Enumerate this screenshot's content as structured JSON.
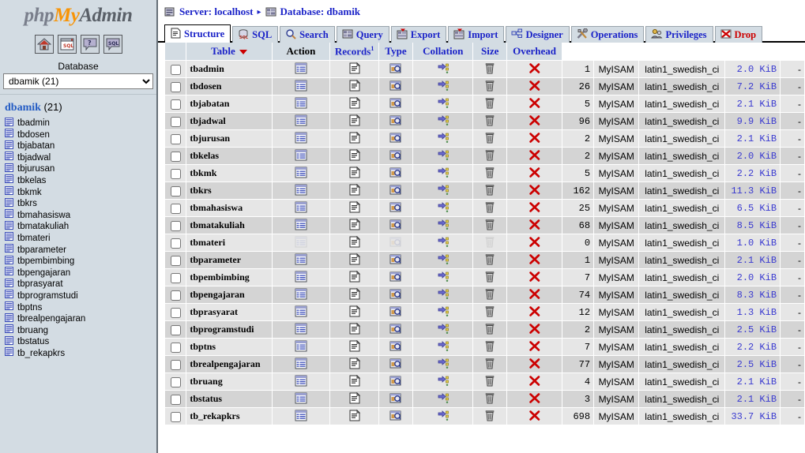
{
  "sidebar": {
    "logo": {
      "php": "php",
      "my": "My",
      "admin": "Admin"
    },
    "quick_icons": [
      {
        "name": "home-icon",
        "title": "Home"
      },
      {
        "name": "sql-window-icon",
        "title": "Query window"
      },
      {
        "name": "documentation-icon",
        "title": "phpMyAdmin documentation"
      },
      {
        "name": "sql-help-icon",
        "title": "MySQL documentation"
      }
    ],
    "database_label": "Database",
    "database_select_value": "dbamik (21)",
    "db_title_name": "dbamik",
    "db_title_count": "(21)",
    "tables": [
      "tbadmin",
      "tbdosen",
      "tbjabatan",
      "tbjadwal",
      "tbjurusan",
      "tbkelas",
      "tbkmk",
      "tbkrs",
      "tbmahasiswa",
      "tbmatakuliah",
      "tbmateri",
      "tbparameter",
      "tbpembimbing",
      "tbpengajaran",
      "tbprasyarat",
      "tbprogramstudi",
      "tbptns",
      "tbrealpengajaran",
      "tbruang",
      "tbstatus",
      "tb_rekapkrs"
    ]
  },
  "breadcrumb": {
    "server": "Server: localhost",
    "separator": "▸",
    "database": "Database: dbamik"
  },
  "tabs": [
    {
      "label": "Structure",
      "icon": "structure-icon",
      "active": true,
      "drop": false
    },
    {
      "label": "SQL",
      "icon": "sql-icon",
      "active": false,
      "drop": false
    },
    {
      "label": "Search",
      "icon": "search-icon",
      "active": false,
      "drop": false
    },
    {
      "label": "Query",
      "icon": "query-icon",
      "active": false,
      "drop": false
    },
    {
      "label": "Export",
      "icon": "export-icon",
      "active": false,
      "drop": false
    },
    {
      "label": "Import",
      "icon": "import-icon",
      "active": false,
      "drop": false
    },
    {
      "label": "Designer",
      "icon": "designer-icon",
      "active": false,
      "drop": false
    },
    {
      "label": "Operations",
      "icon": "operations-icon",
      "active": false,
      "drop": false
    },
    {
      "label": "Privileges",
      "icon": "privileges-icon",
      "active": false,
      "drop": false
    },
    {
      "label": "Drop",
      "icon": "drop-icon",
      "active": false,
      "drop": true
    }
  ],
  "table": {
    "headers": {
      "check": "",
      "name": "Table",
      "action": "Action",
      "records": "Records",
      "records_sup": "1",
      "type": "Type",
      "collation": "Collation",
      "size": "Size",
      "overhead": "Overhead"
    },
    "action_icons": [
      "browse-icon",
      "structure-icon",
      "search-icon",
      "insert-icon",
      "empty-icon",
      "drop-icon"
    ],
    "rows": [
      {
        "name": "tbadmin",
        "records": "1",
        "type": "MyISAM",
        "collation": "latin1_swedish_ci",
        "size": "2.0 KiB",
        "overhead": "-",
        "dimmed": false
      },
      {
        "name": "tbdosen",
        "records": "26",
        "type": "MyISAM",
        "collation": "latin1_swedish_ci",
        "size": "7.2 KiB",
        "overhead": "-",
        "dimmed": false
      },
      {
        "name": "tbjabatan",
        "records": "5",
        "type": "MyISAM",
        "collation": "latin1_swedish_ci",
        "size": "2.1 KiB",
        "overhead": "-",
        "dimmed": false
      },
      {
        "name": "tbjadwal",
        "records": "96",
        "type": "MyISAM",
        "collation": "latin1_swedish_ci",
        "size": "9.9 KiB",
        "overhead": "-",
        "dimmed": false
      },
      {
        "name": "tbjurusan",
        "records": "2",
        "type": "MyISAM",
        "collation": "latin1_swedish_ci",
        "size": "2.1 KiB",
        "overhead": "-",
        "dimmed": false
      },
      {
        "name": "tbkelas",
        "records": "2",
        "type": "MyISAM",
        "collation": "latin1_swedish_ci",
        "size": "2.0 KiB",
        "overhead": "-",
        "dimmed": false
      },
      {
        "name": "tbkmk",
        "records": "5",
        "type": "MyISAM",
        "collation": "latin1_swedish_ci",
        "size": "2.2 KiB",
        "overhead": "-",
        "dimmed": false
      },
      {
        "name": "tbkrs",
        "records": "162",
        "type": "MyISAM",
        "collation": "latin1_swedish_ci",
        "size": "11.3 KiB",
        "overhead": "-",
        "dimmed": false
      },
      {
        "name": "tbmahasiswa",
        "records": "25",
        "type": "MyISAM",
        "collation": "latin1_swedish_ci",
        "size": "6.5 KiB",
        "overhead": "-",
        "dimmed": false
      },
      {
        "name": "tbmatakuliah",
        "records": "68",
        "type": "MyISAM",
        "collation": "latin1_swedish_ci",
        "size": "8.5 KiB",
        "overhead": "-",
        "dimmed": false
      },
      {
        "name": "tbmateri",
        "records": "0",
        "type": "MyISAM",
        "collation": "latin1_swedish_ci",
        "size": "1.0 KiB",
        "overhead": "-",
        "dimmed": true
      },
      {
        "name": "tbparameter",
        "records": "1",
        "type": "MyISAM",
        "collation": "latin1_swedish_ci",
        "size": "2.1 KiB",
        "overhead": "-",
        "dimmed": false
      },
      {
        "name": "tbpembimbing",
        "records": "7",
        "type": "MyISAM",
        "collation": "latin1_swedish_ci",
        "size": "2.0 KiB",
        "overhead": "-",
        "dimmed": false
      },
      {
        "name": "tbpengajaran",
        "records": "74",
        "type": "MyISAM",
        "collation": "latin1_swedish_ci",
        "size": "8.3 KiB",
        "overhead": "-",
        "dimmed": false
      },
      {
        "name": "tbprasyarat",
        "records": "12",
        "type": "MyISAM",
        "collation": "latin1_swedish_ci",
        "size": "1.3 KiB",
        "overhead": "-",
        "dimmed": false
      },
      {
        "name": "tbprogramstudi",
        "records": "2",
        "type": "MyISAM",
        "collation": "latin1_swedish_ci",
        "size": "2.5 KiB",
        "overhead": "-",
        "dimmed": false
      },
      {
        "name": "tbptns",
        "records": "7",
        "type": "MyISAM",
        "collation": "latin1_swedish_ci",
        "size": "2.2 KiB",
        "overhead": "-",
        "dimmed": false
      },
      {
        "name": "tbrealpengajaran",
        "records": "77",
        "type": "MyISAM",
        "collation": "latin1_swedish_ci",
        "size": "2.5 KiB",
        "overhead": "-",
        "dimmed": false
      },
      {
        "name": "tbruang",
        "records": "4",
        "type": "MyISAM",
        "collation": "latin1_swedish_ci",
        "size": "2.1 KiB",
        "overhead": "-",
        "dimmed": false
      },
      {
        "name": "tbstatus",
        "records": "3",
        "type": "MyISAM",
        "collation": "latin1_swedish_ci",
        "size": "2.1 KiB",
        "overhead": "-",
        "dimmed": false
      },
      {
        "name": "tb_rekapkrs",
        "records": "698",
        "type": "MyISAM",
        "collation": "latin1_swedish_ci",
        "size": "33.7 KiB",
        "overhead": "-",
        "dimmed": false
      }
    ]
  },
  "colors": {
    "sidebar_bg": "#d3dce3",
    "link_blue": "#1b23c8",
    "size_blue": "#3a3ad0",
    "drop_red": "#cc0000",
    "row_light": "#e6e6e6",
    "row_dark": "#d4d4d4",
    "logo_orange": "#f89406"
  }
}
